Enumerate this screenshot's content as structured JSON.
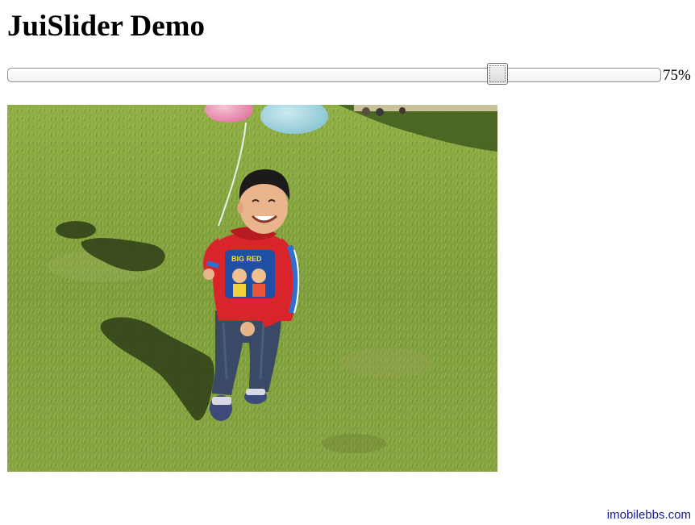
{
  "page": {
    "title": "JuiSlider Demo"
  },
  "slider": {
    "value_label": "75%",
    "value_percent": 75
  },
  "footer": {
    "link_text": "imobilebbs.com",
    "link_color": "#1a1a8f"
  },
  "colors": {
    "grass": "#7a9a3a",
    "shirt_red": "#d8242a",
    "shirt_blue": "#2f6fcf",
    "jeans": "#3a4a66"
  }
}
